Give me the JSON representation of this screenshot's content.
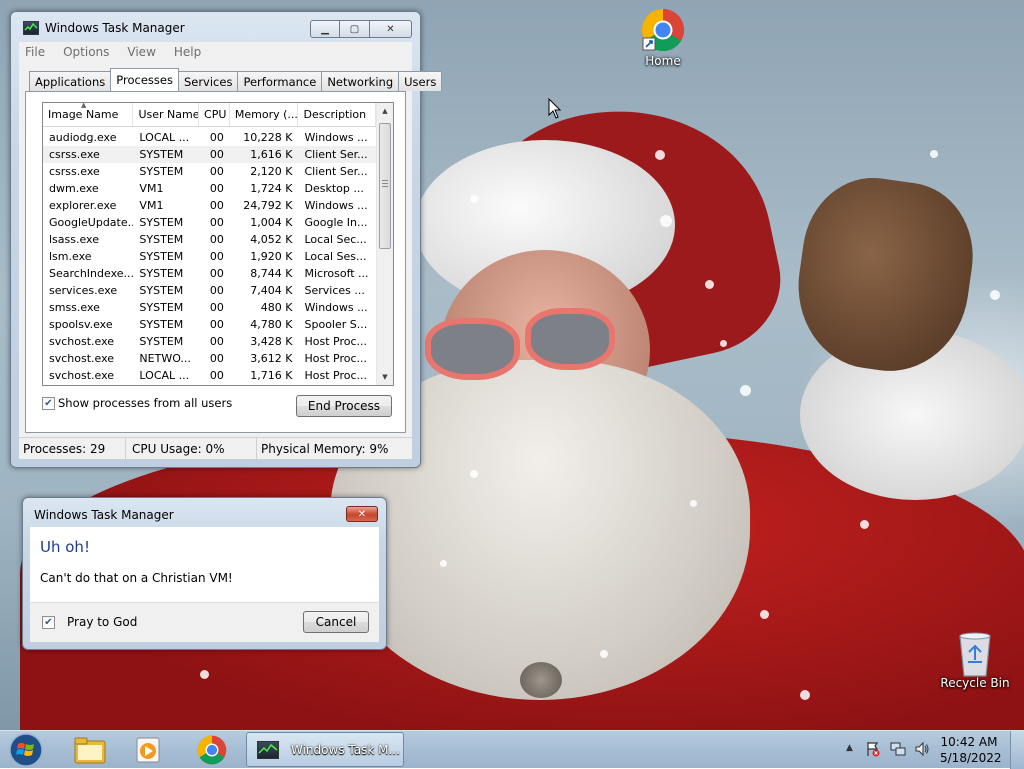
{
  "desktop": {
    "icons": [
      {
        "label": "Home",
        "icon": "chrome-icon"
      },
      {
        "label": "Recycle Bin",
        "icon": "recycle-bin-icon"
      }
    ]
  },
  "task_manager": {
    "title": "Windows Task Manager",
    "menu": [
      "File",
      "Options",
      "View",
      "Help"
    ],
    "tabs": [
      "Applications",
      "Processes",
      "Services",
      "Performance",
      "Networking",
      "Users"
    ],
    "active_tab": "Processes",
    "columns": [
      "Image Name",
      "User Name",
      "CPU",
      "Memory (...",
      "Description"
    ],
    "processes": [
      {
        "name": "audiodg.exe",
        "user": "LOCAL ...",
        "cpu": "00",
        "mem": "10,228 K",
        "desc": "Windows ..."
      },
      {
        "name": "csrss.exe",
        "user": "SYSTEM",
        "cpu": "00",
        "mem": "1,616 K",
        "desc": "Client Ser..."
      },
      {
        "name": "csrss.exe",
        "user": "SYSTEM",
        "cpu": "00",
        "mem": "2,120 K",
        "desc": "Client Ser..."
      },
      {
        "name": "dwm.exe",
        "user": "VM1",
        "cpu": "00",
        "mem": "1,724 K",
        "desc": "Desktop ..."
      },
      {
        "name": "explorer.exe",
        "user": "VM1",
        "cpu": "00",
        "mem": "24,792 K",
        "desc": "Windows ..."
      },
      {
        "name": "GoogleUpdate...",
        "user": "SYSTEM",
        "cpu": "00",
        "mem": "1,004 K",
        "desc": "Google In..."
      },
      {
        "name": "lsass.exe",
        "user": "SYSTEM",
        "cpu": "00",
        "mem": "4,052 K",
        "desc": "Local Sec..."
      },
      {
        "name": "lsm.exe",
        "user": "SYSTEM",
        "cpu": "00",
        "mem": "1,920 K",
        "desc": "Local Ses..."
      },
      {
        "name": "SearchIndexe...",
        "user": "SYSTEM",
        "cpu": "00",
        "mem": "8,744 K",
        "desc": "Microsoft ..."
      },
      {
        "name": "services.exe",
        "user": "SYSTEM",
        "cpu": "00",
        "mem": "7,404 K",
        "desc": "Services ..."
      },
      {
        "name": "smss.exe",
        "user": "SYSTEM",
        "cpu": "00",
        "mem": "480 K",
        "desc": "Windows ..."
      },
      {
        "name": "spoolsv.exe",
        "user": "SYSTEM",
        "cpu": "00",
        "mem": "4,780 K",
        "desc": "Spooler S..."
      },
      {
        "name": "svchost.exe",
        "user": "SYSTEM",
        "cpu": "00",
        "mem": "3,428 K",
        "desc": "Host Proc..."
      },
      {
        "name": "svchost.exe",
        "user": "NETWO...",
        "cpu": "00",
        "mem": "3,612 K",
        "desc": "Host Proc..."
      },
      {
        "name": "svchost.exe",
        "user": "LOCAL ...",
        "cpu": "00",
        "mem": "1,716 K",
        "desc": "Host Proc..."
      }
    ],
    "selected_row": 1,
    "show_all_label": "Show processes from all users",
    "show_all_checked": true,
    "end_process_label": "End Process",
    "status": {
      "processes": "Processes: 29",
      "cpu": "CPU Usage: 0%",
      "memory": "Physical Memory: 9%"
    }
  },
  "dialog": {
    "title": "Windows Task Manager",
    "heading": "Uh oh!",
    "message": "Can't do that on a Christian VM!",
    "checkbox_label": "Pray to God",
    "checkbox_checked": true,
    "cancel_label": "Cancel",
    "heading_color": "#1e3d8f"
  },
  "taskbar": {
    "active_task_label": "Windows Task M...",
    "time": "10:42 AM",
    "date": "5/18/2022"
  }
}
